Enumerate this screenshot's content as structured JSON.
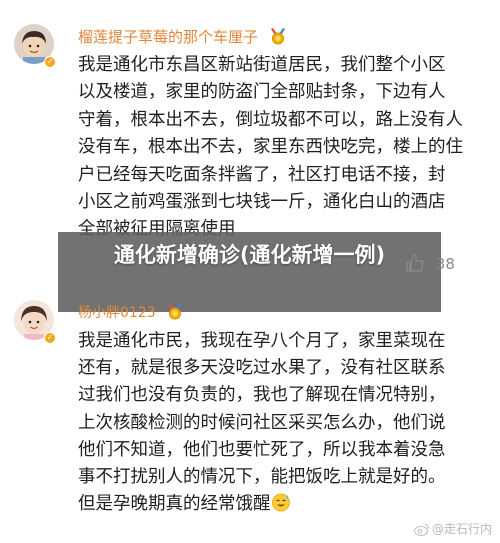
{
  "comments": [
    {
      "username": "榴莲提子草莓的那个车厘子",
      "lines": [
        "我是通化市东昌区新站街道居民，我们整个小区",
        "以及楼道，家里的防盗门全部贴封条，下边有人",
        "守着，根本出不去，倒垃圾都不可以，路上没有人",
        "没有车，根本出不去，家里东西快吃完，楼上的住",
        "户已经每天吃面条拌酱了，社区打电话不接，封",
        "小区之前鸡蛋涨到七块钱一斤，通化白山的酒店",
        "全部被征用隔离使用"
      ]
    },
    {
      "username": "杨小胖0123",
      "lines": [
        "我是通化市民，我现在孕八个月了，家里菜现在",
        "还有，就是很多天没吃过水果了，没有社区联系",
        "过我们也没有负责的，我也了解现在情况特别，",
        "上次核酸检测的时候问社区采买怎么办，他们说",
        "他们不知道，他们也要忙死了，所以我本着没急",
        "事不打扰别人的情况下，能把饭吃上就是好的。",
        "但是孕晚期真的经常饿醒"
      ]
    }
  ],
  "overlay_title": "通化新增确诊(通化新增一例)",
  "like_count": "38",
  "watermark": "@走石行内",
  "colors": {
    "username": "#e3863a",
    "overlay": "#5f5f5f",
    "badge": "#f5a623"
  },
  "icons": {
    "like": "thumbs-up-icon",
    "medal": "medal-badge-icon",
    "verified": "verified-badge-icon",
    "emoji": "sweat-smile-emoji-icon",
    "weibo": "weibo-logo-icon"
  }
}
